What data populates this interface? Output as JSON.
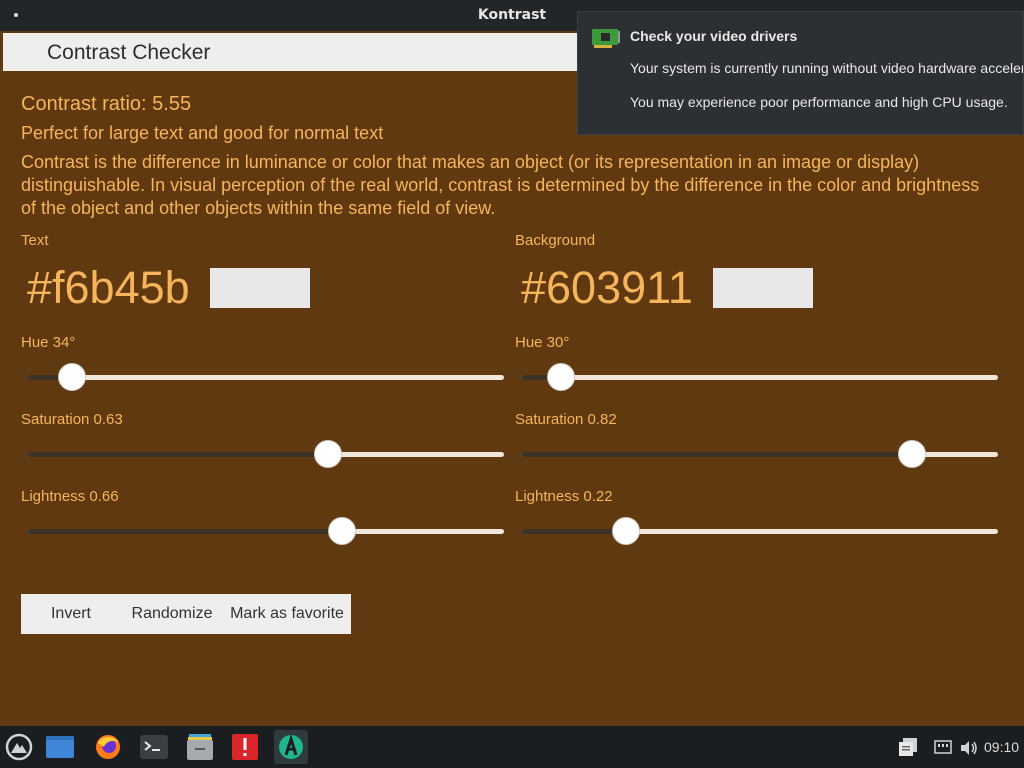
{
  "window": {
    "title": "Kontrast"
  },
  "header": {
    "title": "Contrast Checker"
  },
  "contrast": {
    "ratio_label": "Contrast ratio: 5.55",
    "verdict": "Perfect for large text and good for normal text",
    "description": "Contrast is the difference in luminance or color that makes an object (or its representation in an image or display) distinguishable. In visual perception of the real world, contrast is determined by the difference in the color and brightness of the object and other objects within the same field of view."
  },
  "text_color": {
    "heading": "Text",
    "hex": "#f6b45b",
    "hue_label": "Hue 34°",
    "hue_fraction": 0.095,
    "saturation_label": "Saturation 0.63",
    "saturation_fraction": 0.63,
    "lightness_label": "Lightness 0.66",
    "lightness_fraction": 0.66
  },
  "background_color": {
    "heading": "Background",
    "hex": "#603911",
    "hue_label": "Hue 30°",
    "hue_fraction": 0.083,
    "saturation_label": "Saturation 0.82",
    "saturation_fraction": 0.82,
    "lightness_label": "Lightness 0.22",
    "lightness_fraction": 0.22
  },
  "buttons": {
    "invert": "Invert",
    "randomize": "Randomize",
    "favorite": "Mark as favorite"
  },
  "notification": {
    "title": "Check your video drivers",
    "line1": "Your system is currently running without video hardware acceleration.",
    "line2": "You may experience poor performance and high CPU usage."
  },
  "taskbar": {
    "apps": [
      "launcher-icon",
      "desktop-icon",
      "firefox-icon",
      "terminal-icon",
      "files-icon",
      "alert-app-icon",
      "kontrast-icon"
    ],
    "clock": "09:10"
  },
  "colors": {
    "text": "#f6b45b",
    "background": "#603911"
  }
}
